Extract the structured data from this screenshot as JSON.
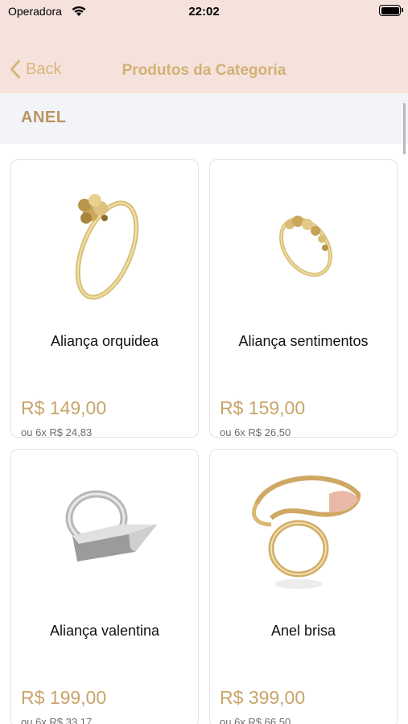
{
  "status_bar": {
    "carrier": "Operadora",
    "time": "22:02"
  },
  "nav": {
    "back_label": "Back",
    "title": "Produtos da Categoria"
  },
  "section": {
    "title": "ANEL"
  },
  "colors": {
    "header_bg": "#f6e2dc",
    "accent_gold": "#d1b176",
    "price": "#c9a46a",
    "section_bg": "#f3f4f8"
  },
  "products": [
    {
      "name": "Aliança orquidea",
      "price": "R$ 149,00",
      "installments": "ou 6x R$ 24,83",
      "image": "gold-ring-orchid"
    },
    {
      "name": "Aliança sentimentos",
      "price": "R$ 159,00",
      "installments": "ou 6x R$ 26,50",
      "image": "gold-ring-beads"
    },
    {
      "name": "Aliança valentina",
      "price": "R$ 199,00",
      "installments": "ou 6x R$ 33,17",
      "image": "silver-ring-bar"
    },
    {
      "name": "Anel brisa",
      "price": "R$ 399,00",
      "installments": "ou 6x R$ 66,50",
      "image": "gold-ring-wave"
    }
  ]
}
